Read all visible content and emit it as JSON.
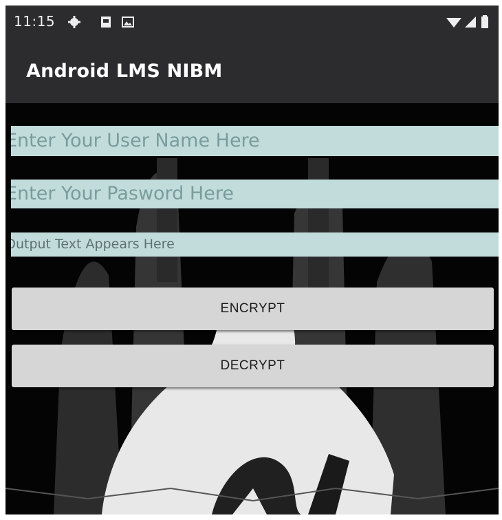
{
  "status_bar": {
    "time": "11:15",
    "left_icons": [
      "gear-icon",
      "sd-card-icon",
      "image-icon"
    ],
    "right_icons": [
      "wifi-icon",
      "signal-icon",
      "battery-icon"
    ]
  },
  "app_bar": {
    "title": "Android LMS NIBM"
  },
  "form": {
    "username_placeholder": "Enter Your User Name Here",
    "password_placeholder": "Enter Your Pasword Here",
    "output_text": "Output Text Appears Here"
  },
  "buttons": {
    "encrypt": "ENCRYPT",
    "decrypt": "DECRYPT"
  },
  "colors": {
    "app_bar": "#2c2c2e",
    "field_background": "#c1dcdb",
    "button_background": "#d6d6d6"
  }
}
